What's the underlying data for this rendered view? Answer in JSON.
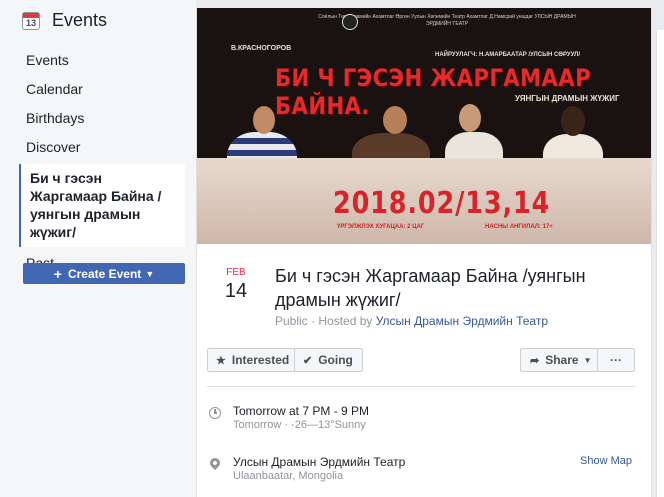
{
  "sidebar": {
    "title": "Events",
    "calendar_icon_day": "13",
    "items": [
      {
        "label": "Events"
      },
      {
        "label": "Calendar"
      },
      {
        "label": "Birthdays"
      },
      {
        "label": "Discover"
      },
      {
        "label": "Би ч гэсэн Жаргамаар Байна /уянгын драмын жүжиг/"
      },
      {
        "label": "Past"
      }
    ],
    "create_button": "Create Event"
  },
  "poster": {
    "header_text": "Соёлын Төв Хөгжмийн Ахамтлаг Өргөн Уулын Хөгжмийн Театр Ахамтлаг Д.Намсрай уншдаг УЛСЫН ДРАМЫН ЭРДМИЙН ТЕАТР",
    "author": "В.КРАСНОГОРОВ",
    "director": "НАЙРУУЛАГЧ: Н.АМАРБААТАР /УЛСЫН СӨРУУЛ/",
    "title": "БИ Ч ГЭСЭН ЖАРГАМААР БАЙНА.",
    "subtitle": "УЯНГЫН ДРАМЫН ЖҮЖИГ",
    "date": "2018.02/13,14",
    "foot_left": "ҮРГЭЛЖЛЭХ ХУГАЦАА: 2 ЦАГ",
    "foot_right": "НАСНЫ АНГИЛАЛ: 17+"
  },
  "event": {
    "month": "FEB",
    "day": "14",
    "title": "Би ч гэсэн Жаргамаар Байна /уянгын драмын жүжиг/",
    "privacy": "Public",
    "hosted_prefix": " · Hosted by ",
    "host": "Улсын Драмын Эрдмийн Театр"
  },
  "actions": {
    "interested": "Interested",
    "going": "Going",
    "share": "Share",
    "more": "···"
  },
  "details": {
    "time_main": "Tomorrow at 7 PM - 9 PM",
    "time_sub": "Tomorrow · -26—13°Sunny",
    "location_main": "Улсын Драмын Эрдмийн Театр",
    "location_sub": "Ulaanbaatar, Mongolia",
    "show_map": "Show Map"
  },
  "colors": {
    "accent": "#4267b2",
    "link": "#365899",
    "month_red": "#f02849",
    "poster_red": "#e32b2b"
  }
}
